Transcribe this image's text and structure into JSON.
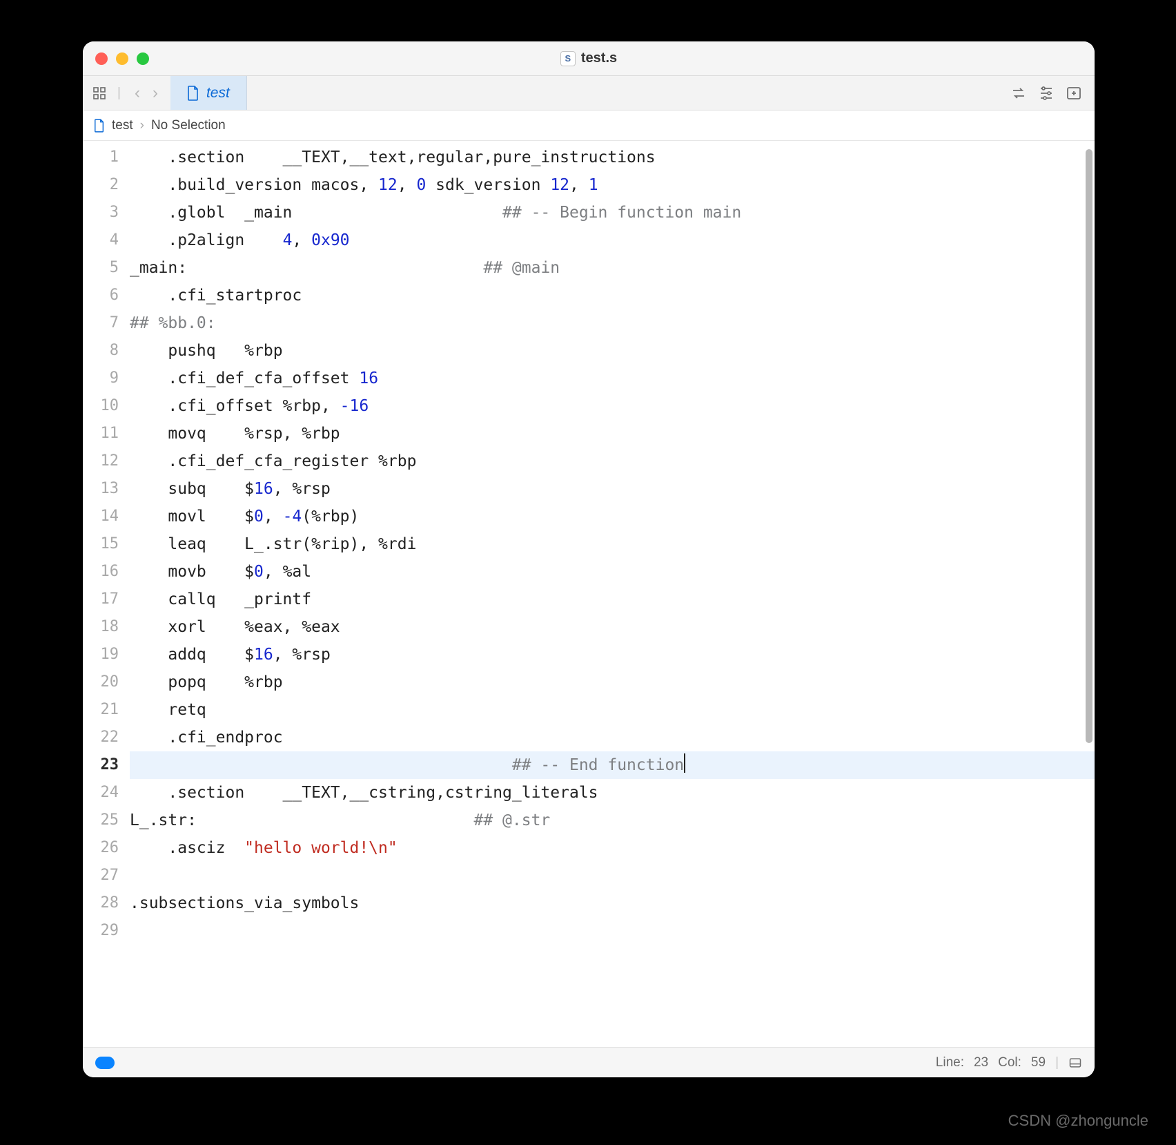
{
  "title": {
    "filename": "test.s",
    "badge": "S"
  },
  "tab": {
    "label": "test"
  },
  "breadcrumb": {
    "file": "test",
    "selection": "No Selection"
  },
  "toolbar_icons": {
    "grid": "grid-icon",
    "back": "chevron-left-icon",
    "forward": "chevron-right-icon",
    "swap": "swap-arrows-icon",
    "adjust": "adjust-icon",
    "add_panel": "add-panel-icon"
  },
  "status": {
    "line_label": "Line:",
    "line": "23",
    "col_label": "Col:",
    "col": "59"
  },
  "code": {
    "total_lines": 29,
    "current_line": 23,
    "lines": [
      {
        "n": 1,
        "segs": [
          {
            "t": "    .section    __TEXT,__text,regular,pure_instructions"
          }
        ]
      },
      {
        "n": 2,
        "segs": [
          {
            "t": "    .build_version macos, "
          },
          {
            "t": "12",
            "c": "num"
          },
          {
            "t": ", "
          },
          {
            "t": "0",
            "c": "num"
          },
          {
            "t": " sdk_version "
          },
          {
            "t": "12",
            "c": "num"
          },
          {
            "t": ", "
          },
          {
            "t": "1",
            "c": "num"
          }
        ]
      },
      {
        "n": 3,
        "segs": [
          {
            "t": "    .globl  _main                      "
          },
          {
            "t": "## -- Begin function main",
            "c": "cmt"
          }
        ]
      },
      {
        "n": 4,
        "segs": [
          {
            "t": "    .p2align    "
          },
          {
            "t": "4",
            "c": "num"
          },
          {
            "t": ", "
          },
          {
            "t": "0x90",
            "c": "num"
          }
        ]
      },
      {
        "n": 5,
        "segs": [
          {
            "t": "_main:                               "
          },
          {
            "t": "## @main",
            "c": "cmt"
          }
        ]
      },
      {
        "n": 6,
        "segs": [
          {
            "t": "    .cfi_startproc"
          }
        ]
      },
      {
        "n": 7,
        "segs": [
          {
            "t": "## %bb.0:",
            "c": "cmt"
          }
        ]
      },
      {
        "n": 8,
        "segs": [
          {
            "t": "    pushq   %rbp"
          }
        ]
      },
      {
        "n": 9,
        "segs": [
          {
            "t": "    .cfi_def_cfa_offset "
          },
          {
            "t": "16",
            "c": "num"
          }
        ]
      },
      {
        "n": 10,
        "segs": [
          {
            "t": "    .cfi_offset %rbp, "
          },
          {
            "t": "-16",
            "c": "num"
          }
        ]
      },
      {
        "n": 11,
        "segs": [
          {
            "t": "    movq    %rsp, %rbp"
          }
        ]
      },
      {
        "n": 12,
        "segs": [
          {
            "t": "    .cfi_def_cfa_register %rbp"
          }
        ]
      },
      {
        "n": 13,
        "segs": [
          {
            "t": "    subq    $"
          },
          {
            "t": "16",
            "c": "num"
          },
          {
            "t": ", %rsp"
          }
        ]
      },
      {
        "n": 14,
        "segs": [
          {
            "t": "    movl    $"
          },
          {
            "t": "0",
            "c": "num"
          },
          {
            "t": ", "
          },
          {
            "t": "-4",
            "c": "num"
          },
          {
            "t": "(%rbp)"
          }
        ]
      },
      {
        "n": 15,
        "segs": [
          {
            "t": "    leaq    L_.str(%rip), %rdi"
          }
        ]
      },
      {
        "n": 16,
        "segs": [
          {
            "t": "    movb    $"
          },
          {
            "t": "0",
            "c": "num"
          },
          {
            "t": ", %al"
          }
        ]
      },
      {
        "n": 17,
        "segs": [
          {
            "t": "    callq   _printf"
          }
        ]
      },
      {
        "n": 18,
        "segs": [
          {
            "t": "    xorl    %eax, %eax"
          }
        ]
      },
      {
        "n": 19,
        "segs": [
          {
            "t": "    addq    $"
          },
          {
            "t": "16",
            "c": "num"
          },
          {
            "t": ", %rsp"
          }
        ]
      },
      {
        "n": 20,
        "segs": [
          {
            "t": "    popq    %rbp"
          }
        ]
      },
      {
        "n": 21,
        "segs": [
          {
            "t": "    retq"
          }
        ]
      },
      {
        "n": 22,
        "segs": [
          {
            "t": "    .cfi_endproc"
          }
        ]
      },
      {
        "n": 23,
        "segs": [
          {
            "t": "                                        "
          },
          {
            "t": "## -- End function",
            "c": "cmt"
          }
        ],
        "caret": true,
        "current": true
      },
      {
        "n": 24,
        "segs": [
          {
            "t": "    .section    __TEXT,__cstring,cstring_literals"
          }
        ]
      },
      {
        "n": 25,
        "segs": [
          {
            "t": "L_.str:                             "
          },
          {
            "t": "## @.str",
            "c": "cmt"
          }
        ]
      },
      {
        "n": 26,
        "segs": [
          {
            "t": "    .asciz  "
          },
          {
            "t": "\"hello world!\\n\"",
            "c": "str"
          }
        ]
      },
      {
        "n": 27,
        "segs": [
          {
            "t": ""
          }
        ]
      },
      {
        "n": 28,
        "segs": [
          {
            "t": ".subsections_via_symbols"
          }
        ]
      },
      {
        "n": 29,
        "segs": [
          {
            "t": ""
          }
        ]
      }
    ]
  },
  "watermark": "CSDN @zhonguncle"
}
